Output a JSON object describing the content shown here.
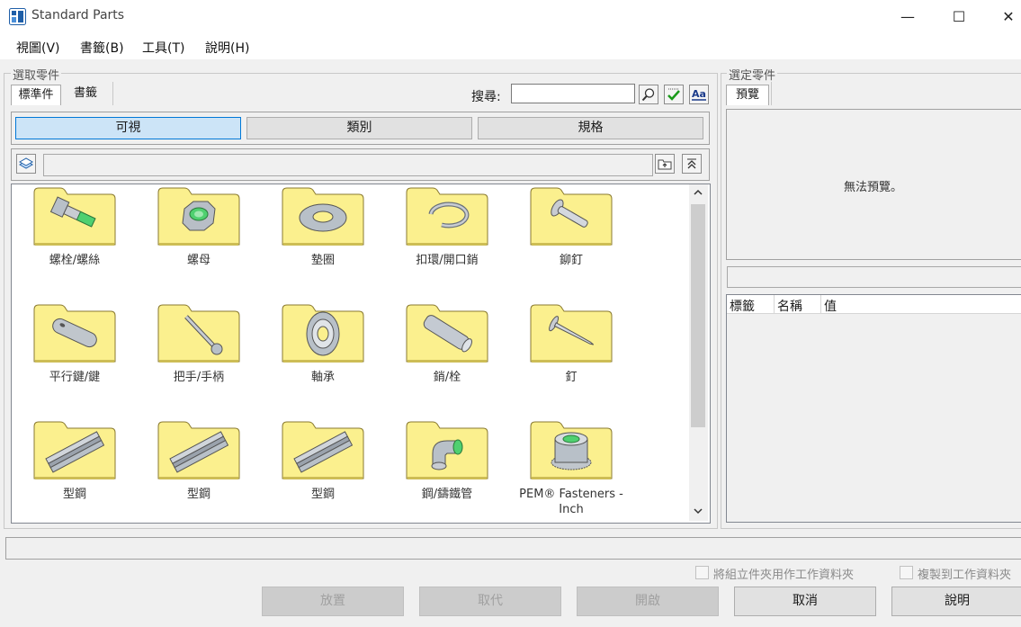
{
  "window": {
    "title": "Standard Parts",
    "minimize": "—",
    "maximize": "☐",
    "close": "✕"
  },
  "menu": [
    "視圖(V)",
    "書籤(B)",
    "工具(T)",
    "說明(H)"
  ],
  "left_group": {
    "label": "選取零件",
    "tabs": [
      "標準件",
      "書籤"
    ],
    "search_label": "搜尋:",
    "search_value": "",
    "view_buttons": [
      "可視",
      "類別",
      "規格"
    ],
    "path_value": "",
    "items": [
      {
        "label": "螺栓/螺絲",
        "icon": "bolt-icon"
      },
      {
        "label": "螺母",
        "icon": "nut-icon"
      },
      {
        "label": "墊圈",
        "icon": "washer-icon"
      },
      {
        "label": "扣環/開口銷",
        "icon": "retaining-ring-icon"
      },
      {
        "label": "鉚釘",
        "icon": "rivet-icon"
      },
      {
        "label": "平行鍵/鍵",
        "icon": "key-icon"
      },
      {
        "label": "把手/手柄",
        "icon": "handle-icon"
      },
      {
        "label": "軸承",
        "icon": "bearing-icon"
      },
      {
        "label": "銷/栓",
        "icon": "pin-icon"
      },
      {
        "label": "釘",
        "icon": "nail-icon"
      },
      {
        "label": "型鋼",
        "icon": "steel-beam-icon"
      },
      {
        "label": "型鋼",
        "icon": "steel-beam-icon"
      },
      {
        "label": "型鋼",
        "icon": "steel-beam-icon"
      },
      {
        "label": "鋼/鑄鐵管",
        "icon": "pipe-fitting-icon"
      },
      {
        "label": "PEM® Fasteners - Inch",
        "icon": "pem-fastener-icon"
      }
    ]
  },
  "right_group": {
    "label": "選定零件",
    "tab": "預覽",
    "preview_text": "無法預覽。",
    "columns": [
      "標籤",
      "名稱",
      "值"
    ]
  },
  "options": {
    "use_assembly_folder": "將組立件夾用作工作資料夾",
    "copy_to_work": "複製到工作資料夾"
  },
  "buttons": {
    "place": "放置",
    "replace": "取代",
    "open": "開啟",
    "cancel": "取消",
    "help": "說明"
  }
}
